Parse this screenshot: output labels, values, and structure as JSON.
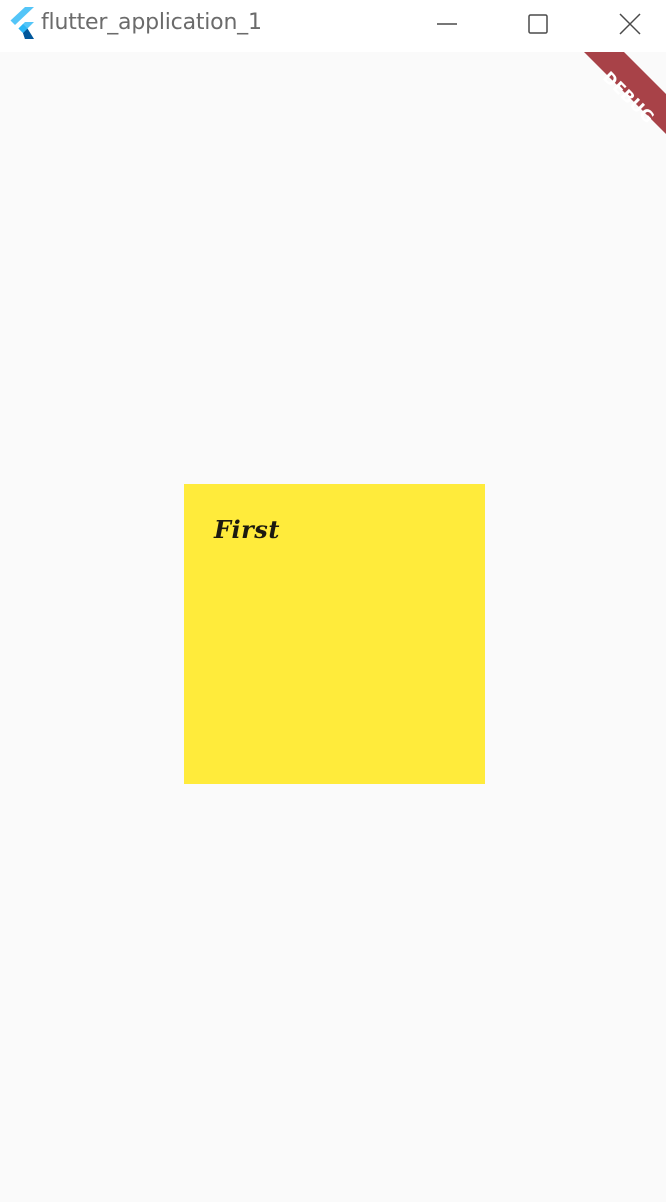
{
  "window": {
    "title": "flutter_application_1",
    "controls": {
      "minimize": "minimize",
      "maximize": "maximize",
      "close": "close"
    }
  },
  "debug_banner": {
    "label": "DEBUG",
    "color": "#a84248"
  },
  "card": {
    "label": "First",
    "background": "#ffeb3b"
  },
  "colors": {
    "background": "#fafafa",
    "titlebar": "#ffffff",
    "flutter_light": "#54c5f8",
    "flutter_dark": "#01579b"
  }
}
